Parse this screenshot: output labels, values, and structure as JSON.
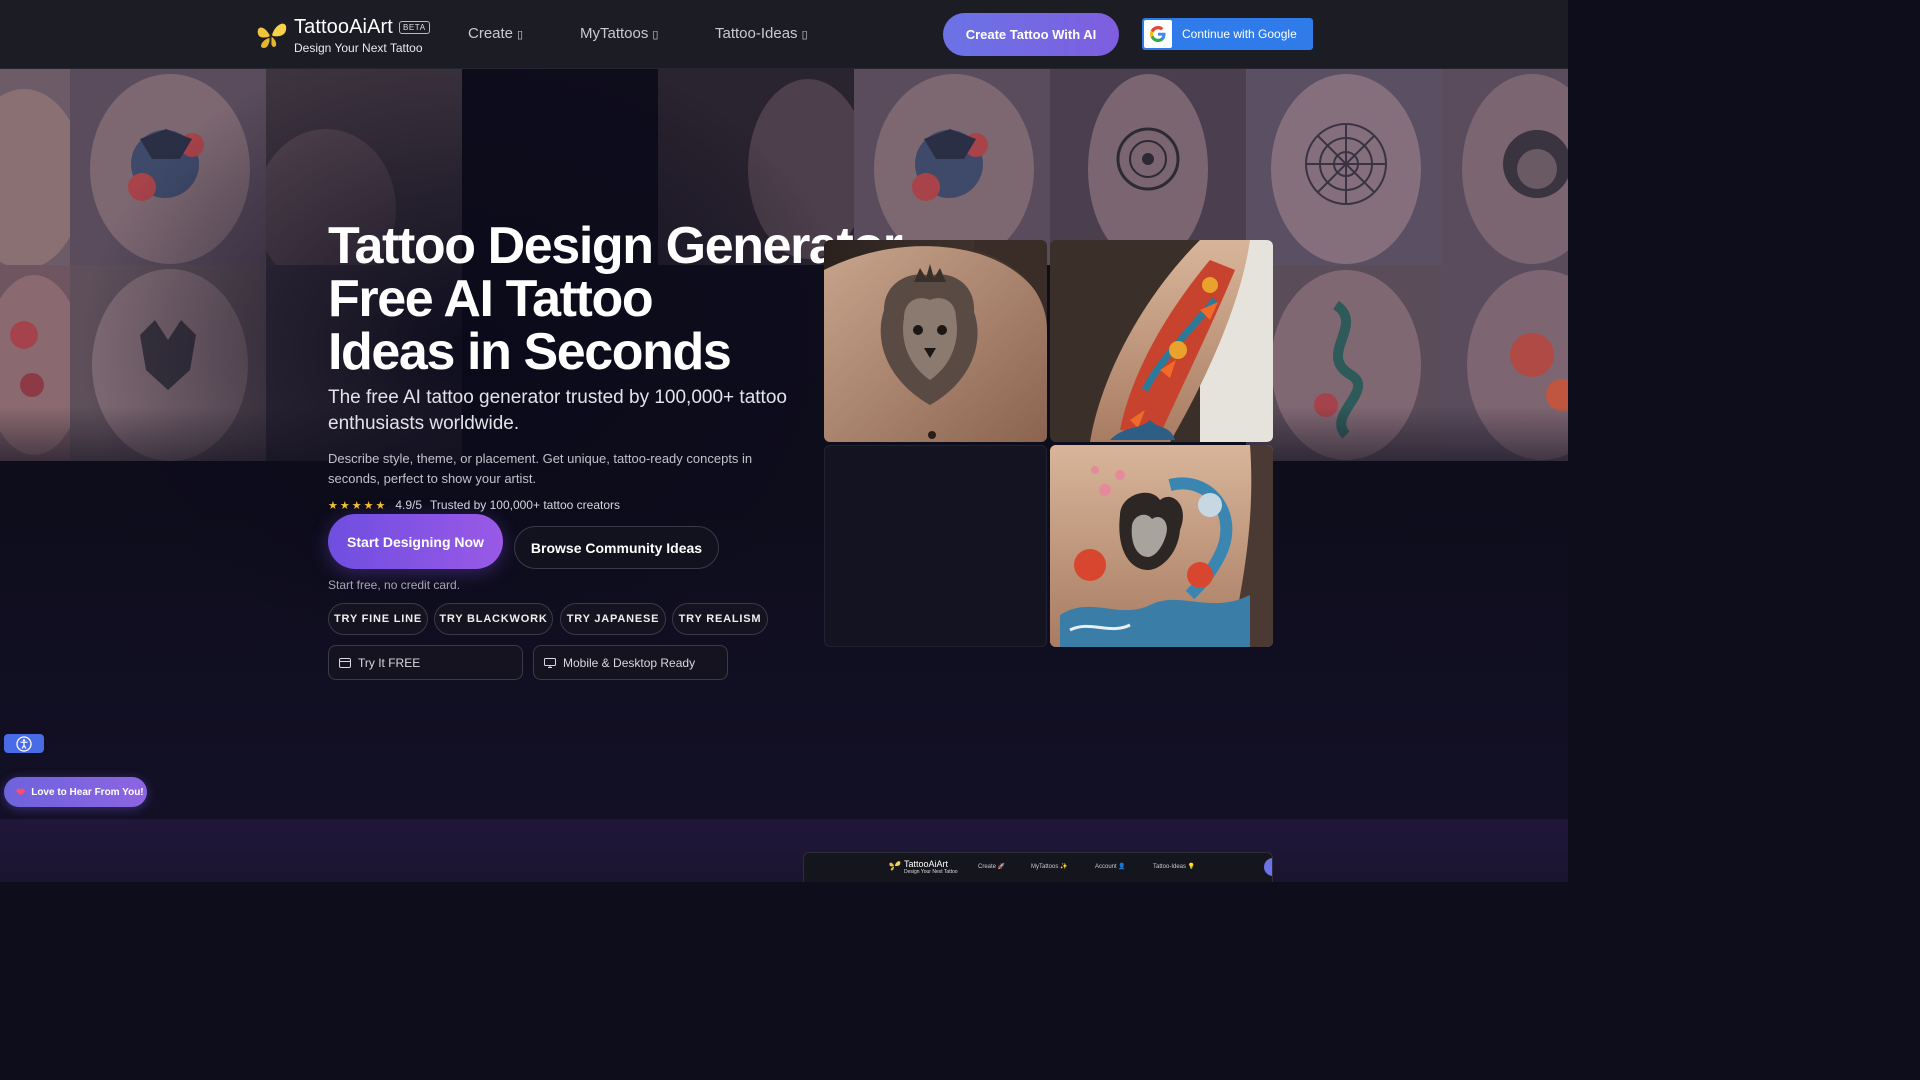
{
  "header": {
    "brand": "TattooAiArt",
    "beta": "BETA",
    "tagline": "Design Your Next Tattoo",
    "nav": [
      {
        "label": "Create",
        "caret": "▯"
      },
      {
        "label": "MyTattoos",
        "caret": "▯"
      },
      {
        "label": "Tattoo-Ideas",
        "caret": "▯"
      }
    ],
    "cta": "Create Tattoo With AI",
    "google": "Continue with Google"
  },
  "hero": {
    "title_lines": [
      "Tattoo Design Generator",
      "Free AI Tattoo",
      "Ideas in Seconds"
    ],
    "subtitle": "The free AI tattoo generator trusted by 100,000+ tattoo enthusiasts worldwide.",
    "description": "Describe style, theme, or placement. Get unique, tattoo-ready concepts in seconds, perfect to show your artist.",
    "stars": "★★★★★",
    "rating": "4.9/5",
    "trusted": "Trusted by 100,000+ tattoo creators",
    "primary_button": "Start Designing Now",
    "secondary_button": "Browse Community Ideas",
    "note": "Start free, no credit card.",
    "chips": [
      "TRY FINE LINE",
      "TRY BLACKWORK",
      "TRY JAPANESE",
      "TRY REALISM"
    ],
    "features": [
      {
        "label": "Try It FREE",
        "icon": "card-icon"
      },
      {
        "label": "Mobile & Desktop Ready",
        "icon": "monitor-icon"
      }
    ]
  },
  "gallery": [
    {
      "name": "lion-chest-tattoo-image"
    },
    {
      "name": "dragon-forearm-tattoo-image"
    },
    {
      "name": "empty-gallery-slot"
    },
    {
      "name": "samurai-dragon-neck-tattoo-image"
    }
  ],
  "widgets": {
    "feedback": "Love to Hear From You!",
    "accessibility_icon": "accessibility-icon"
  },
  "preview": {
    "brand": "TattooAiArt",
    "tagline": "Design Your Next Tattoo",
    "nav": [
      "Create 🚀",
      "MyTattoos ✨",
      "Account 👤",
      "Tattoo-Ideas 💡"
    ]
  },
  "colors": {
    "header_bg": "#1c1c24",
    "page_bg": "#0e0d1c",
    "accent_blue": "#6b73e6",
    "accent_purple": "#8d64e2",
    "google_blue": "#2f7bea",
    "star": "#f4c430"
  }
}
